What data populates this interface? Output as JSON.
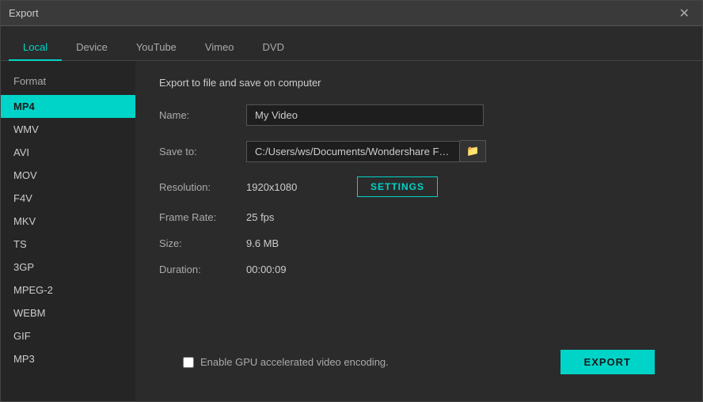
{
  "window": {
    "title": "Export",
    "close_label": "✕"
  },
  "tabs": [
    {
      "id": "local",
      "label": "Local",
      "active": true
    },
    {
      "id": "device",
      "label": "Device",
      "active": false
    },
    {
      "id": "youtube",
      "label": "YouTube",
      "active": false
    },
    {
      "id": "vimeo",
      "label": "Vimeo",
      "active": false
    },
    {
      "id": "dvd",
      "label": "DVD",
      "active": false
    }
  ],
  "sidebar": {
    "header": "Format",
    "items": [
      {
        "id": "mp4",
        "label": "MP4",
        "active": true
      },
      {
        "id": "wmv",
        "label": "WMV",
        "active": false
      },
      {
        "id": "avi",
        "label": "AVI",
        "active": false
      },
      {
        "id": "mov",
        "label": "MOV",
        "active": false
      },
      {
        "id": "f4v",
        "label": "F4V",
        "active": false
      },
      {
        "id": "mkv",
        "label": "MKV",
        "active": false
      },
      {
        "id": "ts",
        "label": "TS",
        "active": false
      },
      {
        "id": "3gp",
        "label": "3GP",
        "active": false
      },
      {
        "id": "mpeg2",
        "label": "MPEG-2",
        "active": false
      },
      {
        "id": "webm",
        "label": "WEBM",
        "active": false
      },
      {
        "id": "gif",
        "label": "GIF",
        "active": false
      },
      {
        "id": "mp3",
        "label": "MP3",
        "active": false
      }
    ]
  },
  "main": {
    "title": "Export to file and save on computer",
    "name_label": "Name:",
    "name_value": "My Video",
    "save_to_label": "Save to:",
    "save_to_value": "C:/Users/ws/Documents/Wondershare Filmo",
    "resolution_label": "Resolution:",
    "resolution_value": "1920x1080",
    "settings_label": "SETTINGS",
    "framerate_label": "Frame Rate:",
    "framerate_value": "25 fps",
    "size_label": "Size:",
    "size_value": "9.6 MB",
    "duration_label": "Duration:",
    "duration_value": "00:00:09",
    "folder_icon": "📁",
    "gpu_label": "Enable GPU accelerated video encoding.",
    "export_label": "EXPORT"
  }
}
